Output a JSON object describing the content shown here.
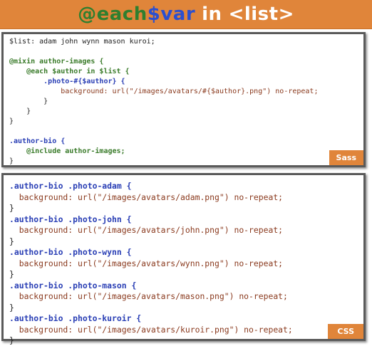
{
  "title": {
    "keyword": "@each",
    "variable": "$var",
    "in": "in",
    "list": "<list>"
  },
  "sass_panel": {
    "badge": "Sass",
    "lines": [
      "$list: adam john wynn mason kuroi;",
      "",
      "@mixin author-images {",
      "    @each $author in $list {",
      "        .photo-#{$author} {",
      "            background: url(\"/images/avatars/#{$author}.png\") no-repeat;",
      "        }",
      "    }",
      "}",
      "",
      ".author-bio {",
      "    @include author-images;",
      "}"
    ]
  },
  "css_panel": {
    "badge": "CSS",
    "rules": [
      {
        "selector": ".author-bio .photo-adam {",
        "decl": "  background: url(\"/images/avatars/adam.png\") no-repeat;",
        "close": "}"
      },
      {
        "selector": ".author-bio .photo-john {",
        "decl": "  background: url(\"/images/avatars/john.png\") no-repeat;",
        "close": "}"
      },
      {
        "selector": ".author-bio .photo-wynn {",
        "decl": "  background: url(\"/images/avatars/wynn.png\") no-repeat;",
        "close": "}"
      },
      {
        "selector": ".author-bio .photo-mason {",
        "decl": "  background: url(\"/images/avatars/mason.png\") no-repeat;",
        "close": "}"
      },
      {
        "selector": ".author-bio .photo-kuroir {",
        "decl": "  background: url(\"/images/avatars/kuroir.png\") no-repeat;",
        "close": "}"
      }
    ]
  },
  "colors": {
    "accent": "#e0853a",
    "keyword_green": "#3a7b2a",
    "selector_blue": "#2a3fb5",
    "string_brown": "#8a3a1e"
  }
}
